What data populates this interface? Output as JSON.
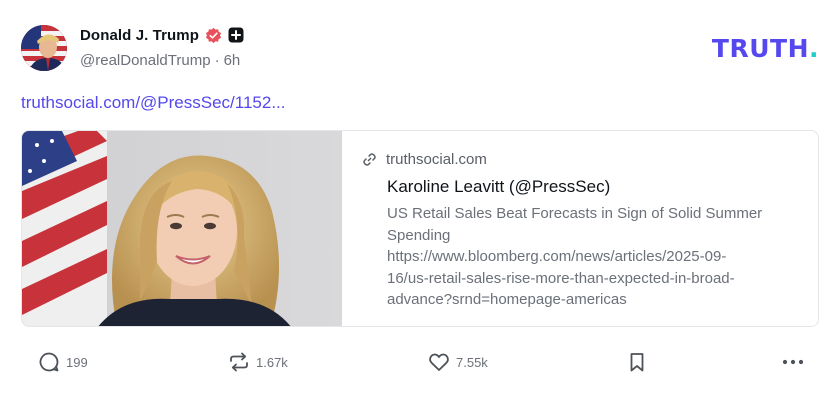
{
  "author": {
    "display_name": "Donald J. Trump",
    "handle": "@realDonaldTrump",
    "time_ago": "6h",
    "separator": "·",
    "verified_icon": "verified-badge-icon",
    "verified_color": "#e8505b",
    "extra_badge_icon": "plus-badge-icon"
  },
  "brand": {
    "logo_text": "TRUTH",
    "logo_dot": ".",
    "logo_color": "#5448ee",
    "dot_color": "#1ecfc3"
  },
  "post": {
    "link_text": "truthsocial.com/@PressSec/1152..."
  },
  "link_card": {
    "domain": "truthsocial.com",
    "title": "Karoline Leavitt (@PressSec)",
    "description_lines": [
      "US Retail Sales Beat Forecasts in Sign of Solid Summer",
      "Spending",
      "https://www.bloomberg.com/news/articles/2025-09-",
      "16/us-retail-sales-rise-more-than-expected-in-broad-",
      "advance?srnd=homepage-americas"
    ],
    "image_icon": "profile-photo"
  },
  "actions": {
    "reply_count": "199",
    "retruth_count": "1.67k",
    "like_count": "7.55k",
    "reply_icon": "comment-icon",
    "retruth_icon": "retruth-icon",
    "like_icon": "heart-icon",
    "bookmark_icon": "bookmark-icon",
    "more_icon": "more-dots-icon"
  }
}
